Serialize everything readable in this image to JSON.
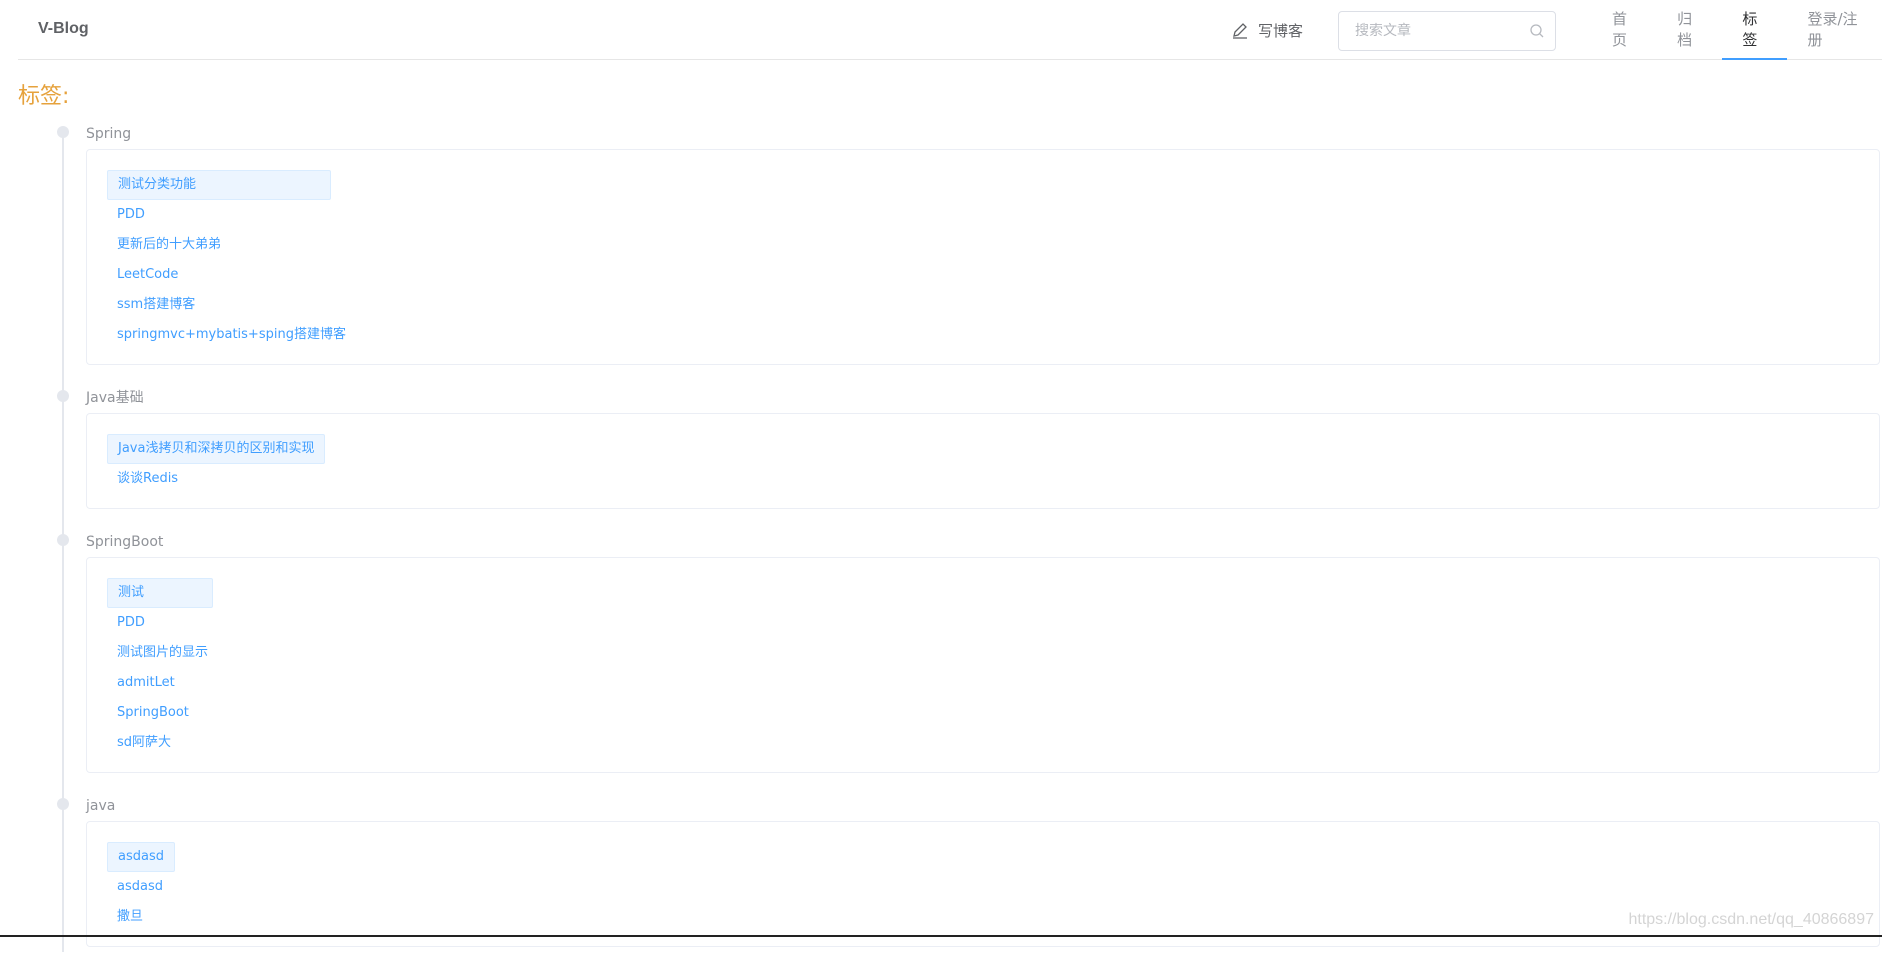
{
  "header": {
    "brand": "V-Blog",
    "write_blog_label": "写博客",
    "search_placeholder": "搜索文章",
    "nav": [
      {
        "label": "首页",
        "active": false
      },
      {
        "label": "归档",
        "active": false
      },
      {
        "label": "标签",
        "active": true
      },
      {
        "label": "登录/注册",
        "active": false
      }
    ]
  },
  "page_title": "标签:",
  "tags": [
    {
      "name": "Spring",
      "articles": [
        "测试分类功能",
        "PDD",
        "更新后的十大弟弟",
        "LeetCode",
        "ssm搭建博客",
        "springmvc+mybatis+sping搭建博客"
      ]
    },
    {
      "name": "Java基础",
      "articles": [
        "Java浅拷贝和深拷贝的区别和实现",
        "谈谈Redis"
      ]
    },
    {
      "name": "SpringBoot",
      "articles": [
        "测试",
        "PDD",
        "测试图片的显示",
        "admitLet",
        "SpringBoot",
        "sd阿萨大"
      ]
    },
    {
      "name": "java",
      "articles": [
        "asdasd",
        "asdasd",
        "撒旦"
      ]
    }
  ],
  "watermark": "https://blog.csdn.net/qq_40866897",
  "colors": {
    "accent": "#409eff",
    "title": "#e6a23c",
    "highlight_bg": "#ecf5ff"
  }
}
